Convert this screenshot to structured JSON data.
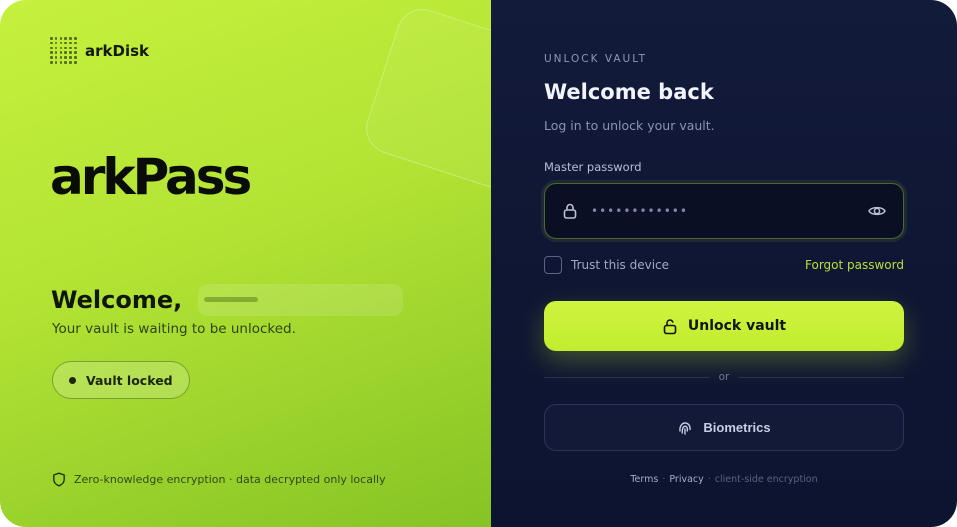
{
  "brand": {
    "name": "arkDisk",
    "wordmark": "arkPass"
  },
  "hero": {
    "welcome": "Welcome,",
    "subtext": "Your vault is waiting to be unlocked.",
    "status_badge": "Vault locked",
    "footer_note": "Zero-knowledge encryption · data decrypted only locally"
  },
  "login": {
    "eyebrow": "UNLOCK VAULT",
    "title": "Welcome back",
    "subtitle": "Log in to unlock your vault.",
    "password_label": "Master password",
    "password_value": "••••••••••••",
    "trust_label": "Trust this device",
    "forgot_label": "Forgot password",
    "unlock_label": "Unlock vault",
    "divider_label": "or",
    "biometrics_label": "Biometrics",
    "footer": {
      "terms": "Terms",
      "privacy": "Privacy",
      "note": "client-side encryption"
    }
  },
  "icons": {
    "brand": "dot-grid-icon",
    "shield": "shield-icon",
    "lock": "lock-icon",
    "eye": "eye-icon",
    "unlock": "unlock-icon",
    "fingerprint": "fingerprint-icon"
  },
  "colors": {
    "accent": "#c6f03d",
    "panel_dark": "#111936",
    "link": "#b6e13a"
  }
}
